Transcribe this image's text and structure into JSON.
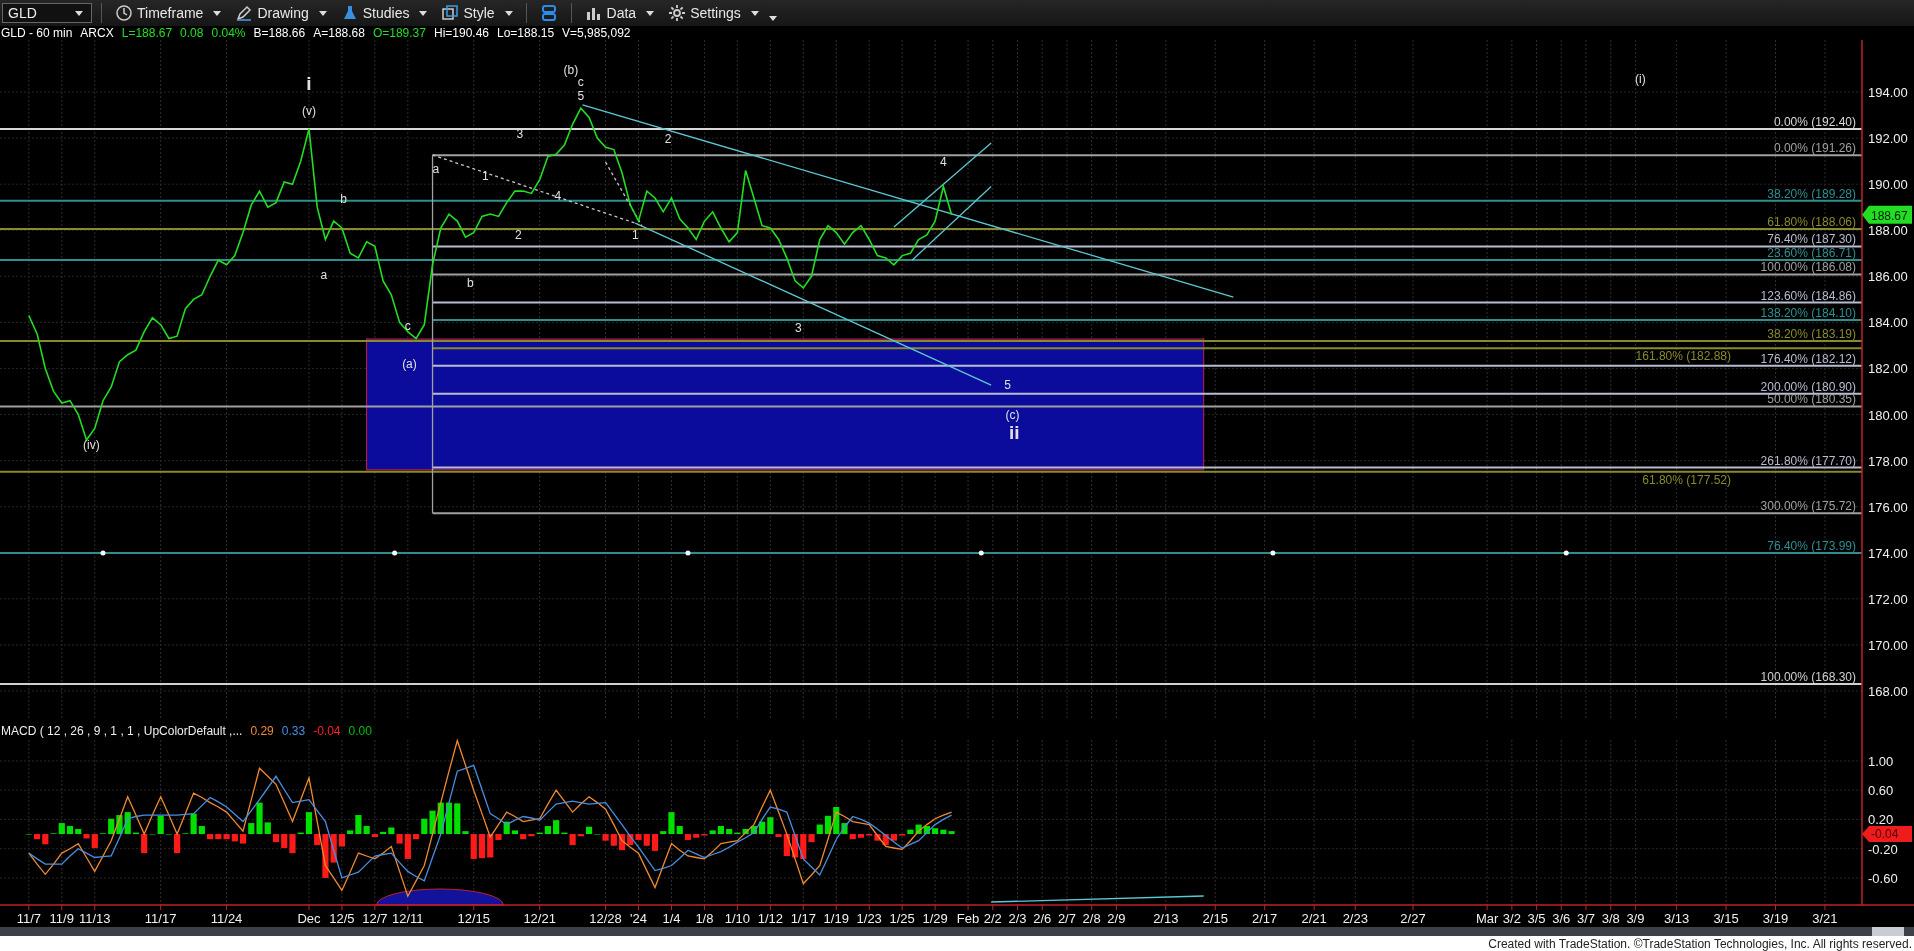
{
  "toolbar": {
    "symbol": "GLD",
    "menus_left": [
      "Timeframe",
      "Drawing",
      "Studies",
      "Style"
    ],
    "menus_right": [
      "Data",
      "Settings"
    ]
  },
  "quote_line": [
    {
      "text": "GLD - 60 min",
      "color": "#ffffff"
    },
    {
      "text": "ARCX",
      "color": "#ffffff"
    },
    {
      "text": "L=188.67",
      "color": "#22e022"
    },
    {
      "text": "0.08",
      "color": "#22e022"
    },
    {
      "text": "0.04%",
      "color": "#22e022"
    },
    {
      "text": "B=188.66",
      "color": "#ffffff"
    },
    {
      "text": "A=188.68",
      "color": "#ffffff"
    },
    {
      "text": "O=189.37",
      "color": "#22e022"
    },
    {
      "text": "Hi=190.46",
      "color": "#ffffff"
    },
    {
      "text": "Lo=188.15",
      "color": "#ffffff"
    },
    {
      "text": "V=5,985,092",
      "color": "#ffffff"
    }
  ],
  "price_chart": {
    "last_price_flag": "188.67",
    "wave_labels": [
      "i",
      "(v)",
      "b",
      "a",
      "c",
      "(a)",
      "(iv)",
      "a",
      "1",
      "b",
      "2",
      "3",
      "4",
      "(b)",
      "c",
      "5",
      "2",
      "1",
      "3",
      "4",
      "5",
      "(c)",
      "ii",
      "(i)"
    ],
    "chart_data": {
      "type": "line",
      "categories": [
        null,
        null,
        null,
        null,
        null,
        null,
        null,
        null,
        null,
        null,
        null,
        null,
        null,
        null,
        null,
        null,
        null,
        null,
        null,
        null,
        null,
        null,
        null,
        null,
        null,
        null,
        null,
        null,
        null,
        null,
        null,
        null,
        null,
        null,
        null,
        null,
        null,
        null,
        null,
        null,
        null,
        null,
        null,
        null,
        null,
        null,
        null,
        null,
        null,
        null,
        null,
        null,
        null,
        null,
        null,
        null,
        null,
        null,
        null,
        null,
        null,
        null,
        null,
        null,
        null,
        null,
        null,
        null,
        null,
        null,
        null,
        null,
        null,
        null,
        null,
        null,
        null,
        null,
        null,
        null,
        null,
        null,
        null,
        null,
        null,
        null,
        null,
        null,
        null,
        null,
        null,
        null,
        null,
        null,
        null,
        null,
        null,
        null,
        null,
        null,
        null,
        null,
        null,
        null,
        null,
        null,
        null,
        null,
        null,
        null,
        null,
        null,
        null,
        null,
        null,
        null,
        null,
        null,
        null,
        null,
        null,
        null,
        null,
        null,
        null,
        null,
        null,
        null,
        null,
        null,
        null,
        null,
        null,
        null,
        null,
        null,
        null,
        null,
        null,
        null,
        null,
        null,
        null,
        null,
        null,
        null,
        null,
        null,
        null,
        null,
        null,
        null,
        null,
        null,
        null,
        null,
        null,
        null,
        null,
        null,
        null,
        null,
        null,
        null,
        null,
        null,
        null,
        null,
        null,
        null,
        null,
        null,
        null,
        null,
        null,
        null,
        null,
        null,
        null,
        null,
        null,
        null,
        null,
        null,
        null,
        null,
        null,
        null,
        null,
        null,
        null,
        null,
        null,
        null,
        null,
        null,
        null,
        null,
        null,
        null,
        null,
        null,
        null,
        null,
        null,
        null,
        null,
        null,
        null,
        null,
        null,
        null,
        null,
        null,
        null,
        null,
        null,
        null,
        null,
        null,
        null,
        null,
        null,
        null,
        null,
        null
      ],
      "series": [
        {
          "color": "#22dd22",
          "values": [
            null,
            null,
            null,
            184.3,
            183.5,
            182.0,
            181.0,
            180.5,
            180.6,
            180.0,
            178.9,
            179.4,
            180.6,
            181.2,
            182.3,
            182.6,
            182.8,
            183.6,
            184.2,
            183.9,
            183.3,
            183.4,
            184.6,
            185.0,
            185.2,
            186.0,
            186.7,
            186.5,
            186.9,
            187.9,
            189.1,
            189.7,
            189.0,
            189.2,
            190.1,
            190.0,
            191.0,
            192.4,
            189.0,
            187.6,
            188.4,
            188.1,
            187.0,
            186.8,
            187.5,
            187.3,
            185.8,
            185.2,
            184.0,
            183.6,
            183.3,
            183.9,
            186.5,
            188.1,
            188.7,
            188.4,
            187.7,
            187.9,
            188.6,
            188.7,
            188.6,
            189.2,
            189.7,
            189.7,
            189.6,
            190.2,
            191.2,
            191.3,
            191.7,
            192.6,
            193.3,
            192.9,
            192.0,
            191.6,
            191.5,
            190.5,
            189.1,
            188.4,
            189.7,
            189.4,
            188.8,
            189.4,
            188.5,
            188.1,
            187.6,
            188.4,
            188.8,
            188.1,
            187.5,
            187.9,
            190.6,
            189.4,
            188.2,
            188.1,
            187.6,
            186.8,
            185.8,
            185.5,
            186.0,
            187.6,
            188.2,
            187.9,
            187.4,
            187.9,
            188.2,
            187.6,
            186.9,
            186.8,
            186.5,
            186.9,
            187.0,
            187.6,
            187.8,
            188.4,
            189.9,
            188.67,
            null,
            null,
            null,
            null,
            null,
            null,
            null,
            null,
            null,
            null,
            null,
            null,
            null,
            null,
            null,
            null,
            null,
            null,
            null,
            null,
            null,
            null,
            null,
            null,
            null,
            null,
            null,
            null,
            null,
            null,
            null,
            null,
            null,
            null,
            null,
            null,
            null,
            null,
            null,
            null,
            null,
            null,
            null,
            null,
            null,
            null,
            null,
            null,
            null,
            null,
            null,
            null,
            null,
            null,
            null,
            null,
            null,
            null,
            null,
            null,
            null,
            null,
            null,
            null,
            null,
            null,
            null,
            null,
            null,
            null,
            null,
            null,
            null,
            null,
            null,
            null,
            null,
            null,
            null,
            null,
            null,
            null,
            null,
            null,
            null,
            null,
            null,
            null,
            null,
            null,
            null,
            null,
            null,
            null,
            null,
            null,
            null,
            null,
            null,
            null,
            null,
            null,
            null,
            null,
            null,
            null,
            null,
            null,
            null,
            null
          ]
        }
      ],
      "ylim": [
        166.74,
        196.26
      ],
      "grid": true,
      "bands": [
        {
          "axis": "y",
          "from": 177.6,
          "to": 183.28,
          "color": "#0c0c9c"
        }
      ],
      "yticks": [
        {
          "value": 194,
          "label": "194.00"
        },
        {
          "value": 192,
          "label": "192.00"
        },
        {
          "value": 190,
          "label": "190.00"
        },
        {
          "value": 188,
          "label": "188.00"
        },
        {
          "value": 186,
          "label": "186.00"
        },
        {
          "value": 184,
          "label": "184.00"
        },
        {
          "value": 182,
          "label": "182.00"
        },
        {
          "value": 180,
          "label": "180.00"
        },
        {
          "value": 178,
          "label": "178.00"
        },
        {
          "value": 176,
          "label": "176.00"
        },
        {
          "value": 174,
          "label": "174.00"
        },
        {
          "value": 172,
          "label": "172.00"
        },
        {
          "value": 170,
          "label": "170.00"
        },
        {
          "value": 168,
          "label": "168.00"
        }
      ],
      "ref_lines": [
        {
          "axis": "y",
          "value": 192.4,
          "label": "0.00% (192.40)",
          "color": "#d8d8d8"
        },
        {
          "axis": "y",
          "value": 191.26,
          "label": "0.00% (191.26)",
          "color": "#a0a0a0"
        },
        {
          "axis": "y",
          "value": 189.28,
          "label": "38.20% (189.28)",
          "color": "#2f8f8f"
        },
        {
          "axis": "y",
          "value": 188.06,
          "label": "61.80% (188.06)",
          "color": "#8a8a2a"
        },
        {
          "axis": "y",
          "value": 187.3,
          "label": "76.40% (187.30)",
          "color": "#b8bcd0"
        },
        {
          "axis": "y",
          "value": 186.71,
          "label": "23.60% (186.71)",
          "color": "#2f8f8f"
        },
        {
          "axis": "y",
          "value": 186.08,
          "label": "100.00% (186.08)",
          "color": "#a0a0a0"
        },
        {
          "axis": "y",
          "value": 184.86,
          "label": "123.60% (184.86)",
          "color": "#b8bcd0"
        },
        {
          "axis": "y",
          "value": 184.1,
          "label": "138.20% (184.10)",
          "color": "#2f8f8f"
        },
        {
          "axis": "y",
          "value": 183.19,
          "label": "38.20% (183.19)",
          "color": "#8a8a2a"
        },
        {
          "axis": "y",
          "value": 182.88,
          "label": "161.80% (182.88)",
          "color": "#8a8a2a"
        },
        {
          "axis": "y",
          "value": 182.12,
          "label": "176.40% (182.12)",
          "color": "#b8bcd0"
        },
        {
          "axis": "y",
          "value": 180.9,
          "label": "200.00% (180.90)",
          "color": "#b8bcd0"
        },
        {
          "axis": "y",
          "value": 180.35,
          "label": "50.00% (180.35)",
          "color": "#a0a0a0"
        },
        {
          "axis": "y",
          "value": 177.7,
          "label": "261.80% (177.70)",
          "color": "#b8bcd0"
        },
        {
          "axis": "y",
          "value": 177.52,
          "label": "61.80% (177.52)",
          "color": "#8a8a2a"
        },
        {
          "axis": "y",
          "value": 175.72,
          "label": "300.00% (175.72)",
          "color": "#a0a0a0"
        },
        {
          "axis": "y",
          "value": 173.99,
          "label": "76.40% (173.99)",
          "color": "#2f8f8f"
        },
        {
          "axis": "y",
          "value": 168.3,
          "label": "100.00% (168.30)",
          "color": "#d0d0d0"
        }
      ]
    }
  },
  "macd": {
    "legend_values": [
      {
        "text": "0.29",
        "color": "#f08a30"
      },
      {
        "text": "0.33",
        "color": "#4a8ee0"
      },
      {
        "text": "-0.04",
        "color": "#ff2020"
      },
      {
        "text": "0.00",
        "color": "#00c000"
      }
    ],
    "last_value_flag": "-0.04",
    "chart_data": {
      "type": "line",
      "title": "MACD ( 12 , 26 , 9 , 1 , 1 , UpColorDefault ,...",
      "grid": true,
      "categories": [
        null,
        null,
        null,
        "11/7",
        null,
        null,
        null,
        "11/9",
        null,
        null,
        null,
        "11/13",
        null,
        null,
        null,
        null,
        null,
        null,
        null,
        "11/17",
        null,
        null,
        null,
        null,
        null,
        null,
        null,
        "11/24",
        null,
        null,
        null,
        null,
        null,
        null,
        null,
        null,
        null,
        "Dec",
        null,
        null,
        null,
        "12/5",
        null,
        null,
        null,
        "12/7",
        null,
        null,
        null,
        "12/11",
        null,
        null,
        null,
        null,
        null,
        null,
        null,
        "12/15",
        null,
        null,
        null,
        null,
        null,
        null,
        null,
        "12/21",
        null,
        null,
        null,
        null,
        null,
        null,
        null,
        "12/28",
        null,
        null,
        null,
        "'24",
        null,
        null,
        null,
        "1/4",
        null,
        null,
        null,
        "1/8",
        null,
        null,
        null,
        "1/10",
        null,
        null,
        null,
        "1/12",
        null,
        null,
        null,
        "1/17",
        null,
        null,
        null,
        "1/19",
        null,
        null,
        null,
        "1/23",
        null,
        null,
        null,
        "1/25",
        null,
        null,
        null,
        "1/29",
        null,
        null,
        null,
        "Feb",
        null,
        null,
        "2/2",
        null,
        null,
        "2/3",
        null,
        null,
        "2/6",
        null,
        null,
        "2/7",
        null,
        null,
        "2/8",
        null,
        null,
        "2/9",
        null,
        null,
        null,
        null,
        null,
        "2/13",
        null,
        null,
        null,
        null,
        null,
        "2/15",
        null,
        null,
        null,
        null,
        null,
        "2/17",
        null,
        null,
        null,
        null,
        null,
        "2/21",
        null,
        null,
        null,
        null,
        "2/23",
        null,
        null,
        null,
        null,
        null,
        null,
        "2/27",
        null,
        null,
        null,
        null,
        null,
        null,
        null,
        null,
        "Mar",
        null,
        null,
        "3/2",
        null,
        null,
        "3/5",
        null,
        null,
        "3/6",
        null,
        null,
        "3/7",
        null,
        null,
        "3/8",
        null,
        null,
        "3/9",
        null,
        null,
        null,
        null,
        "3/13",
        null,
        null,
        null,
        null,
        null,
        "3/15",
        null,
        null,
        null,
        null,
        null,
        "3/19",
        null,
        null,
        null,
        null,
        null,
        "3/21",
        null,
        null,
        null,
        null
      ],
      "series": [
        {
          "type": "bar",
          "color": "#00e000",
          "values": [
            null,
            null,
            null,
            0,
            null,
            null,
            0.01,
            0.15,
            0.11,
            0.07,
            null,
            null,
            0.01,
            0.21,
            0.26,
            0.3,
            0.02,
            null,
            0,
            0.25,
            0,
            null,
            0.01,
            0.28,
            0.11,
            null,
            null,
            null,
            null,
            null,
            0.15,
            0.43,
            0.16,
            null,
            null,
            null,
            0.02,
            0.3,
            null,
            null,
            null,
            null,
            0.05,
            0.26,
            0.11,
            null,
            0.03,
            0.09,
            null,
            null,
            null,
            0.21,
            0.32,
            0.43,
            0.43,
            0.42,
            0.04,
            null,
            null,
            null,
            null,
            0.17,
            0.05,
            null,
            null,
            0.02,
            0.11,
            0.19,
            0.02,
            null,
            null,
            0.1,
            0,
            null,
            null,
            null,
            null,
            null,
            null,
            null,
            0.04,
            0.3,
            0.11,
            null,
            null,
            null,
            0.05,
            0.11,
            0.07,
            0.02,
            0.07,
            0.11,
            0.17,
            0.23,
            null,
            null,
            null,
            null,
            null,
            0.13,
            0.25,
            0.37,
            0.15,
            null,
            null,
            null,
            null,
            null,
            null,
            null,
            0.06,
            0.13,
            0.11,
            0.08,
            0.06,
            0.04,
            null,
            null,
            null,
            null,
            null,
            null,
            null,
            null,
            null,
            null,
            null,
            null,
            null,
            null,
            null,
            null,
            null,
            null,
            null,
            null,
            null,
            null,
            null,
            null,
            null,
            null,
            null,
            null,
            null,
            null,
            null,
            null,
            null,
            null,
            null,
            null,
            null,
            null,
            null,
            null,
            null,
            null,
            null,
            null,
            null,
            null,
            null,
            null,
            null,
            null,
            null,
            null,
            null,
            null,
            null,
            null,
            null,
            null,
            null,
            null,
            null,
            null,
            null,
            null,
            null,
            null,
            null,
            null,
            null,
            null,
            null,
            null,
            null,
            null,
            null,
            null,
            null,
            null,
            null,
            null,
            null,
            null,
            null,
            null,
            null,
            null,
            null,
            null,
            null,
            null,
            null,
            null,
            null,
            null,
            null,
            null,
            null,
            null,
            null,
            null,
            null,
            null,
            null,
            null,
            null,
            null,
            null,
            null,
            null,
            null
          ]
        },
        {
          "type": "bar",
          "color": "#ff1a1a",
          "values": [
            null,
            null,
            null,
            null,
            -0.07,
            -0.14,
            null,
            null,
            null,
            null,
            -0.06,
            -0.19,
            null,
            null,
            null,
            null,
            null,
            -0.26,
            null,
            null,
            null,
            -0.26,
            null,
            null,
            null,
            -0.07,
            -0.07,
            -0.07,
            -0.1,
            -0.13,
            null,
            null,
            null,
            -0.11,
            -0.19,
            -0.26,
            null,
            null,
            -0.15,
            -0.6,
            -0.39,
            -0.17,
            null,
            null,
            null,
            -0.04,
            null,
            null,
            -0.13,
            -0.34,
            -0.07,
            null,
            null,
            null,
            null,
            null,
            null,
            -0.34,
            -0.33,
            -0.32,
            -0.08,
            null,
            null,
            -0.07,
            -0.03,
            null,
            null,
            null,
            null,
            -0.15,
            -0.03,
            null,
            null,
            -0.09,
            -0.16,
            -0.22,
            -0.15,
            -0.08,
            -0.16,
            -0.23,
            null,
            null,
            null,
            -0.08,
            -0.05,
            -0.02,
            null,
            null,
            null,
            null,
            null,
            null,
            null,
            null,
            -0.04,
            -0.3,
            -0.32,
            -0.34,
            -0.11,
            null,
            null,
            null,
            null,
            -0.07,
            -0.05,
            -0.02,
            -0.09,
            -0.15,
            -0.09,
            -0.02,
            null,
            null,
            null,
            null,
            null,
            null,
            null,
            null,
            null,
            null,
            null,
            null,
            null,
            null,
            null,
            null,
            null,
            null,
            null,
            null,
            null,
            null,
            null,
            null,
            null,
            null,
            null,
            null,
            null,
            null,
            null,
            null,
            null,
            null,
            null,
            null,
            null,
            null,
            null,
            null,
            null,
            null,
            null,
            null,
            null,
            null,
            null,
            null,
            null,
            null,
            null,
            null,
            null,
            null,
            null,
            null,
            null,
            null,
            null,
            null,
            null,
            null,
            null,
            null,
            null,
            null,
            null,
            null,
            null,
            null,
            null,
            null,
            null,
            null,
            null,
            null,
            null,
            null,
            null,
            null,
            null,
            null,
            null,
            null,
            null,
            null,
            null,
            null,
            null,
            null,
            null,
            null,
            null,
            null,
            null,
            null,
            null,
            null,
            null,
            null,
            null,
            null,
            null,
            null,
            null,
            null,
            null,
            null,
            null,
            null,
            null,
            null,
            null,
            null,
            null,
            null
          ]
        },
        {
          "color": "#f08a30",
          "values": [
            null,
            null,
            null,
            -0.26,
            -0.41,
            -0.55,
            -0.41,
            -0.26,
            -0.2,
            -0.13,
            -0.32,
            -0.51,
            -0.3,
            -0.09,
            0.21,
            0.51,
            0.26,
            0,
            0.26,
            0.51,
            0.26,
            0,
            0.28,
            0.56,
            0.5,
            0.43,
            0.37,
            0.3,
            0.17,
            0.04,
            0.47,
            0.9,
            0.79,
            0.68,
            0.43,
            0.17,
            0.47,
            0.77,
            0.17,
            -0.43,
            -0.6,
            -0.77,
            -0.52,
            -0.26,
            -0.3,
            -0.34,
            -0.26,
            -0.17,
            -0.51,
            -0.85,
            -0.64,
            -0.43,
            0,
            0.43,
            0.86,
            1.28,
            0.94,
            0.6,
            0.28,
            -0.04,
            0.13,
            0.3,
            0.24,
            0.17,
            0.19,
            0.21,
            0.41,
            0.6,
            0.45,
            0.3,
            0.41,
            0.51,
            0.43,
            0.34,
            0.13,
            -0.09,
            -0.18,
            -0.26,
            -0.5,
            -0.73,
            -0.43,
            -0.13,
            -0.22,
            -0.3,
            -0.32,
            -0.34,
            -0.24,
            -0.13,
            -0.11,
            -0.09,
            0.02,
            0.13,
            0.37,
            0.6,
            0.3,
            0,
            -0.34,
            -0.68,
            -0.56,
            -0.43,
            -0.07,
            0.3,
            0.24,
            0.17,
            0.15,
            0.13,
            -0.02,
            -0.17,
            -0.19,
            -0.21,
            -0.09,
            0.04,
            0.13,
            0.21,
            0.26,
            0.3,
            null,
            null,
            null,
            null,
            null,
            null,
            null,
            null,
            null,
            null,
            null,
            null,
            null,
            null,
            null,
            null,
            null,
            null,
            null,
            null,
            null,
            null,
            null,
            null,
            null,
            null,
            null,
            null,
            null,
            null,
            null,
            null,
            null,
            null,
            null,
            null,
            null,
            null,
            null,
            null,
            null,
            null,
            null,
            null,
            null,
            null,
            null,
            null,
            null,
            null,
            null,
            null,
            null,
            null,
            null,
            null,
            null,
            null,
            null,
            null,
            null,
            null,
            null,
            null,
            null,
            null,
            null,
            null,
            null,
            null,
            null,
            null,
            null,
            null,
            null,
            null,
            null,
            null,
            null,
            null,
            null,
            null,
            null,
            null,
            null,
            null,
            null,
            null,
            null,
            null,
            null,
            null,
            null,
            null,
            null,
            null,
            null,
            null,
            null,
            null,
            null,
            null,
            null,
            null,
            null,
            null,
            null,
            null,
            null,
            null
          ]
        },
        {
          "color": "#4a8ee0",
          "values": [
            null,
            null,
            null,
            -0.26,
            -0.34,
            -0.41,
            -0.41,
            -0.41,
            -0.3,
            -0.2,
            -0.26,
            -0.32,
            -0.31,
            -0.3,
            -0.05,
            0.21,
            0.24,
            0.26,
            0.26,
            0.26,
            0.26,
            0.26,
            0.27,
            0.28,
            0.39,
            0.5,
            0.44,
            0.37,
            0.27,
            0.17,
            0.32,
            0.47,
            0.63,
            0.79,
            0.61,
            0.43,
            0.45,
            0.47,
            0.32,
            0.17,
            -0.22,
            -0.6,
            -0.56,
            -0.52,
            -0.41,
            -0.3,
            -0.28,
            -0.26,
            -0.39,
            -0.51,
            -0.58,
            -0.64,
            -0.32,
            0,
            0.43,
            0.86,
            0.9,
            0.94,
            0.61,
            0.28,
            0.21,
            0.13,
            0.19,
            0.24,
            0.22,
            0.19,
            0.3,
            0.41,
            0.43,
            0.45,
            0.43,
            0.41,
            0.42,
            0.43,
            0.28,
            0.13,
            -0.03,
            -0.18,
            -0.34,
            -0.5,
            -0.47,
            -0.43,
            -0.33,
            -0.22,
            -0.27,
            -0.32,
            -0.28,
            -0.24,
            -0.18,
            -0.11,
            -0.05,
            0.02,
            0.2,
            0.37,
            0.34,
            0.3,
            -0.02,
            -0.34,
            -0.45,
            -0.56,
            -0.32,
            -0.07,
            0.09,
            0.24,
            0.2,
            0.15,
            0.07,
            -0.02,
            -0.11,
            -0.19,
            -0.14,
            -0.09,
            0.02,
            0.13,
            0.2,
            0.26,
            null,
            null,
            null,
            null,
            null,
            null,
            null,
            null,
            null,
            null,
            null,
            null,
            null,
            null,
            null,
            null,
            null,
            null,
            null,
            null,
            null,
            null,
            null,
            null,
            null,
            null,
            null,
            null,
            null,
            null,
            null,
            null,
            null,
            null,
            null,
            null,
            null,
            null,
            null,
            null,
            null,
            null,
            null,
            null,
            null,
            null,
            null,
            null,
            null,
            null,
            null,
            null,
            null,
            null,
            null,
            null,
            null,
            null,
            null,
            null,
            null,
            null,
            null,
            null,
            null,
            null,
            null,
            null,
            null,
            null,
            null,
            null,
            null,
            null,
            null,
            null,
            null,
            null,
            null,
            null,
            null,
            null,
            null,
            null,
            null,
            null,
            null,
            null,
            null,
            null,
            null,
            null,
            null,
            null,
            null,
            null,
            null,
            null,
            null,
            null,
            null,
            null,
            null,
            null,
            null,
            null,
            null,
            null,
            null,
            null
          ]
        }
      ],
      "ylim": [
        -0.97,
        1.56
      ],
      "yticks": [
        {
          "value": 1,
          "label": "1.00"
        },
        {
          "value": 0.6,
          "label": "0.60"
        },
        {
          "value": 0.2,
          "label": "0.20"
        },
        {
          "value": -0.2,
          "label": "-0.20"
        },
        {
          "value": -0.6,
          "label": "-0.60"
        }
      ]
    }
  },
  "footer": "Created with TradeStation. ©TradeStation Technologies, Inc. All rights reserved."
}
